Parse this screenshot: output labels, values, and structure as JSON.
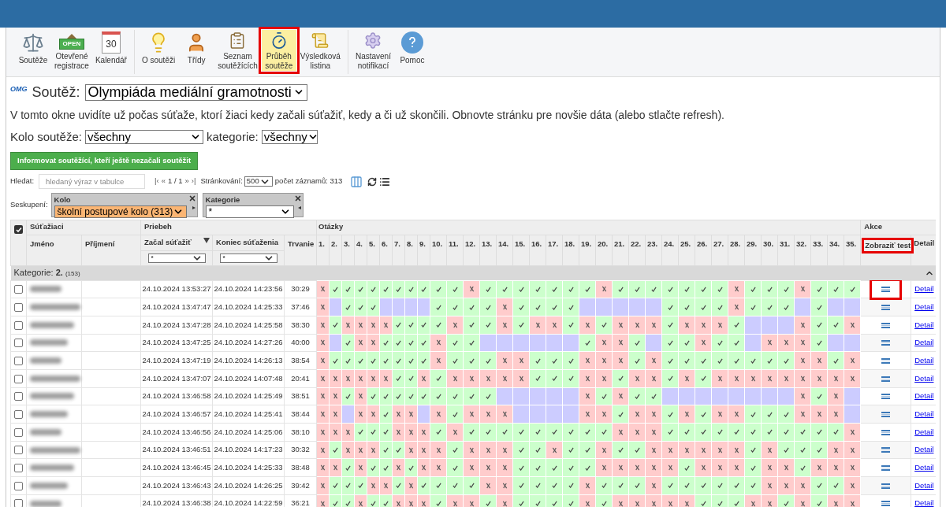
{
  "toolbar": {
    "groups": [
      [
        {
          "kind": "scale",
          "label": "Soutěže",
          "selected": false,
          "highlighted": false
        },
        {
          "kind": "sign",
          "sign_text": "OPEN",
          "label": "Otevřené\nregistrace",
          "selected": false,
          "highlighted": false
        },
        {
          "kind": "calendar",
          "sign_text": "30",
          "label": "Kalendář",
          "selected": false,
          "highlighted": false
        }
      ],
      [
        {
          "kind": "bulb",
          "label": "O soutěži",
          "selected": false,
          "highlighted": false
        },
        {
          "kind": "person",
          "label": "Třídy",
          "selected": false,
          "highlighted": false
        },
        {
          "kind": "clipboard",
          "label": "Seznam\nsoutěžících",
          "selected": false,
          "highlighted": false
        },
        {
          "kind": "stopwatch",
          "label": "Průběh\nsoutěže",
          "selected": true,
          "highlighted": true
        },
        {
          "kind": "certificate",
          "label": "Výsledková\nlistina",
          "selected": false,
          "highlighted": false
        }
      ],
      [
        {
          "kind": "gear",
          "label": "Nastavení\nnotifikací",
          "selected": false,
          "highlighted": false
        },
        {
          "kind": "help",
          "label": "Pomoc",
          "selected": false,
          "highlighted": false
        }
      ]
    ]
  },
  "competition": {
    "logo": "OMG",
    "label": "Soutěž:",
    "value": "Olympiáda mediální gramotnosti"
  },
  "description": "V tomto okne uvidíte už počas súťaže, ktorí žiaci kedy začali súťažiť, kedy a či už skončili. Obnovte stránku pre novšie dáta (alebo stlačte refresh).",
  "filters": [
    {
      "label": "Kolo soutěže:",
      "value": "všechny"
    },
    {
      "label": "kategorie:",
      "value": "všechny"
    }
  ],
  "notify_button": "Informovat soutěžící, kteří ještě nezačali soutěžit",
  "search": {
    "label": "Hledat:",
    "placeholder": "hledaný výraz v tabulce"
  },
  "pager": {
    "first": "|‹",
    "prev": "«",
    "page": "1 / 1",
    "next": "»",
    "last": "›|",
    "page_size_label": "Stránkování:",
    "page_size": "500",
    "count": "počet záznamů: 313"
  },
  "grouping": {
    "label": "Seskupení:",
    "groups": [
      {
        "title": "Kolo",
        "value": "školní postupové kolo (313)",
        "active": true,
        "arrow": "▸"
      },
      {
        "title": "Kategorie",
        "value": "*",
        "active": false,
        "arrow": "◂"
      }
    ]
  },
  "table": {
    "header_checked": true,
    "groups": [
      "Súťažiaci",
      "Priebeh",
      "Otázky",
      "Akce"
    ],
    "columns": [
      "Jméno",
      "Příjmení",
      "Začal súťažiť",
      "Koniec súťaženia",
      "Trvanie"
    ],
    "column_filters": [
      "*",
      "*"
    ],
    "questions": [
      "1.",
      "2.",
      "3.",
      "4.",
      "5.",
      "6.",
      "7.",
      "8.",
      "9.",
      "10.",
      "11.",
      "12.",
      "13.",
      "14.",
      "15.",
      "16.",
      "17.",
      "18.",
      "19.",
      "20.",
      "21.",
      "22.",
      "23.",
      "24.",
      "25.",
      "26.",
      "27.",
      "28.",
      "29.",
      "30.",
      "31.",
      "32.",
      "33.",
      "34.",
      "35."
    ],
    "actions": [
      {
        "label": "Zobraziť test",
        "highlighted": true
      },
      {
        "label": "Detail",
        "highlighted": false
      }
    ],
    "group_row": {
      "label": "Kategorie: **2.**",
      "count": "(153)",
      "expanded": true
    },
    "rows": [
      {
        "checked": false,
        "start": "24.10.2024 13:53:27",
        "end": "24.10.2024 14:23:56",
        "duration": "30:29",
        "test_highlighted": true,
        "detail": "Detail",
        "answers": [
          {
            "kind": "wrong"
          },
          {
            "kind": "correct"
          },
          {
            "kind": "correct"
          },
          {
            "kind": "correct"
          },
          {
            "kind": "correct"
          },
          {
            "kind": "correct"
          },
          {
            "kind": "correct"
          },
          {
            "kind": "correct"
          },
          {
            "kind": "correct"
          },
          {
            "kind": "correct"
          },
          {
            "kind": "correct"
          },
          {
            "kind": "wrong"
          },
          {
            "kind": "correct"
          },
          {
            "kind": "correct"
          },
          {
            "kind": "correct"
          },
          {
            "kind": "correct"
          },
          {
            "kind": "correct"
          },
          {
            "kind": "correct"
          },
          {
            "kind": "correct"
          },
          {
            "kind": "wrong"
          },
          {
            "kind": "correct"
          },
          {
            "kind": "correct"
          },
          {
            "kind": "correct"
          },
          {
            "kind": "correct"
          },
          {
            "kind": "correct"
          },
          {
            "kind": "correct"
          },
          {
            "kind": "correct"
          },
          {
            "kind": "wrong"
          },
          {
            "kind": "correct"
          },
          {
            "kind": "correct"
          },
          {
            "kind": "correct"
          },
          {
            "kind": "wrong"
          },
          {
            "kind": "correct"
          },
          {
            "kind": "correct"
          },
          {
            "kind": "correct"
          }
        ]
      },
      {
        "checked": false,
        "start": "24.10.2024 13:47:47",
        "end": "24.10.2024 14:25:33",
        "duration": "37:46",
        "test_highlighted": false,
        "detail": "Detail",
        "answers": [
          {
            "kind": "wrong"
          },
          {
            "kind": "empty"
          },
          {
            "kind": "correct"
          },
          {
            "kind": "correct"
          },
          {
            "kind": "correct"
          },
          {
            "kind": "empty"
          },
          {
            "kind": "empty"
          },
          {
            "kind": "empty"
          },
          {
            "kind": "empty"
          },
          {
            "kind": "correct"
          },
          {
            "kind": "correct"
          },
          {
            "kind": "correct"
          },
          {
            "kind": "correct"
          },
          {
            "kind": "wrong"
          },
          {
            "kind": "correct"
          },
          {
            "kind": "correct"
          },
          {
            "kind": "correct"
          },
          {
            "kind": "correct"
          },
          {
            "kind": "empty"
          },
          {
            "kind": "empty"
          },
          {
            "kind": "empty"
          },
          {
            "kind": "empty"
          },
          {
            "kind": "empty"
          },
          {
            "kind": "correct"
          },
          {
            "kind": "correct"
          },
          {
            "kind": "correct"
          },
          {
            "kind": "correct"
          },
          {
            "kind": "wrong"
          },
          {
            "kind": "correct"
          },
          {
            "kind": "correct"
          },
          {
            "kind": "correct"
          },
          {
            "kind": "empty"
          },
          {
            "kind": "correct"
          },
          {
            "kind": "empty"
          },
          {
            "kind": "empty"
          }
        ]
      },
      {
        "checked": false,
        "start": "24.10.2024 13:47:28",
        "end": "24.10.2024 14:25:58",
        "duration": "38:30",
        "test_highlighted": false,
        "detail": "Detail",
        "answers": [
          {
            "kind": "wrong"
          },
          {
            "kind": "correct"
          },
          {
            "kind": "wrong"
          },
          {
            "kind": "wrong"
          },
          {
            "kind": "wrong"
          },
          {
            "kind": "wrong"
          },
          {
            "kind": "correct"
          },
          {
            "kind": "correct"
          },
          {
            "kind": "correct"
          },
          {
            "kind": "correct"
          },
          {
            "kind": "wrong"
          },
          {
            "kind": "correct"
          },
          {
            "kind": "correct"
          },
          {
            "kind": "wrong"
          },
          {
            "kind": "correct"
          },
          {
            "kind": "wrong"
          },
          {
            "kind": "wrong"
          },
          {
            "kind": "correct"
          },
          {
            "kind": "wrong"
          },
          {
            "kind": "correct"
          },
          {
            "kind": "wrong"
          },
          {
            "kind": "wrong"
          },
          {
            "kind": "wrong"
          },
          {
            "kind": "correct"
          },
          {
            "kind": "wrong"
          },
          {
            "kind": "wrong"
          },
          {
            "kind": "wrong"
          },
          {
            "kind": "correct"
          },
          {
            "kind": "empty"
          },
          {
            "kind": "empty"
          },
          {
            "kind": "empty"
          },
          {
            "kind": "wrong"
          },
          {
            "kind": "correct"
          },
          {
            "kind": "correct"
          },
          {
            "kind": "wrong"
          }
        ]
      },
      {
        "checked": false,
        "start": "24.10.2024 13:47:25",
        "end": "24.10.2024 14:27:26",
        "duration": "40:00",
        "test_highlighted": false,
        "detail": "Detail",
        "answers": [
          {
            "kind": "wrong"
          },
          {
            "kind": "empty"
          },
          {
            "kind": "correct"
          },
          {
            "kind": "wrong"
          },
          {
            "kind": "wrong"
          },
          {
            "kind": "correct"
          },
          {
            "kind": "correct"
          },
          {
            "kind": "correct"
          },
          {
            "kind": "correct"
          },
          {
            "kind": "wrong"
          },
          {
            "kind": "correct"
          },
          {
            "kind": "correct"
          },
          {
            "kind": "empty"
          },
          {
            "kind": "empty"
          },
          {
            "kind": "empty"
          },
          {
            "kind": "empty"
          },
          {
            "kind": "empty"
          },
          {
            "kind": "empty"
          },
          {
            "kind": "correct"
          },
          {
            "kind": "wrong"
          },
          {
            "kind": "wrong"
          },
          {
            "kind": "correct"
          },
          {
            "kind": "empty"
          },
          {
            "kind": "correct"
          },
          {
            "kind": "correct"
          },
          {
            "kind": "wrong"
          },
          {
            "kind": "correct"
          },
          {
            "kind": "correct"
          },
          {
            "kind": "empty"
          },
          {
            "kind": "wrong"
          },
          {
            "kind": "wrong"
          },
          {
            "kind": "wrong"
          },
          {
            "kind": "correct"
          },
          {
            "kind": "empty"
          },
          {
            "kind": "empty"
          }
        ]
      },
      {
        "checked": false,
        "start": "24.10.2024 13:47:19",
        "end": "24.10.2024 14:26:13",
        "duration": "38:54",
        "test_highlighted": false,
        "detail": "Detail",
        "answers": [
          {
            "kind": "wrong"
          },
          {
            "kind": "correct"
          },
          {
            "kind": "correct"
          },
          {
            "kind": "correct"
          },
          {
            "kind": "correct"
          },
          {
            "kind": "correct"
          },
          {
            "kind": "correct"
          },
          {
            "kind": "correct"
          },
          {
            "kind": "correct"
          },
          {
            "kind": "wrong"
          },
          {
            "kind": "correct"
          },
          {
            "kind": "correct"
          },
          {
            "kind": "correct"
          },
          {
            "kind": "wrong"
          },
          {
            "kind": "wrong"
          },
          {
            "kind": "correct"
          },
          {
            "kind": "correct"
          },
          {
            "kind": "correct"
          },
          {
            "kind": "wrong"
          },
          {
            "kind": "wrong"
          },
          {
            "kind": "wrong"
          },
          {
            "kind": "correct"
          },
          {
            "kind": "wrong"
          },
          {
            "kind": "correct"
          },
          {
            "kind": "correct"
          },
          {
            "kind": "correct"
          },
          {
            "kind": "correct"
          },
          {
            "kind": "correct"
          },
          {
            "kind": "correct"
          },
          {
            "kind": "correct"
          },
          {
            "kind": "correct"
          },
          {
            "kind": "wrong"
          },
          {
            "kind": "wrong"
          },
          {
            "kind": "correct"
          },
          {
            "kind": "wrong"
          }
        ]
      },
      {
        "checked": false,
        "start": "24.10.2024 13:47:07",
        "end": "24.10.2024 14:07:48",
        "duration": "20:41",
        "test_highlighted": false,
        "detail": "Detail",
        "answers": [
          {
            "kind": "wrong"
          },
          {
            "kind": "wrong"
          },
          {
            "kind": "wrong"
          },
          {
            "kind": "wrong"
          },
          {
            "kind": "wrong"
          },
          {
            "kind": "wrong"
          },
          {
            "kind": "correct"
          },
          {
            "kind": "correct"
          },
          {
            "kind": "wrong"
          },
          {
            "kind": "correct"
          },
          {
            "kind": "wrong"
          },
          {
            "kind": "wrong"
          },
          {
            "kind": "wrong"
          },
          {
            "kind": "wrong"
          },
          {
            "kind": "wrong"
          },
          {
            "kind": "correct"
          },
          {
            "kind": "correct"
          },
          {
            "kind": "correct"
          },
          {
            "kind": "wrong"
          },
          {
            "kind": "wrong"
          },
          {
            "kind": "correct"
          },
          {
            "kind": "wrong"
          },
          {
            "kind": "wrong"
          },
          {
            "kind": "correct"
          },
          {
            "kind": "wrong"
          },
          {
            "kind": "correct"
          },
          {
            "kind": "wrong"
          },
          {
            "kind": "wrong"
          },
          {
            "kind": "wrong"
          },
          {
            "kind": "wrong"
          },
          {
            "kind": "wrong"
          },
          {
            "kind": "wrong"
          },
          {
            "kind": "wrong"
          },
          {
            "kind": "wrong"
          },
          {
            "kind": "wrong"
          }
        ]
      },
      {
        "checked": false,
        "start": "24.10.2024 13:46:58",
        "end": "24.10.2024 14:25:49",
        "duration": "38:51",
        "test_highlighted": false,
        "detail": "Detail",
        "answers": [
          {
            "kind": "wrong"
          },
          {
            "kind": "wrong"
          },
          {
            "kind": "correct"
          },
          {
            "kind": "wrong"
          },
          {
            "kind": "correct"
          },
          {
            "kind": "correct"
          },
          {
            "kind": "correct"
          },
          {
            "kind": "correct"
          },
          {
            "kind": "correct"
          },
          {
            "kind": "correct"
          },
          {
            "kind": "correct"
          },
          {
            "kind": "correct"
          },
          {
            "kind": "correct"
          },
          {
            "kind": "empty"
          },
          {
            "kind": "empty"
          },
          {
            "kind": "empty"
          },
          {
            "kind": "empty"
          },
          {
            "kind": "empty"
          },
          {
            "kind": "wrong"
          },
          {
            "kind": "correct"
          },
          {
            "kind": "wrong"
          },
          {
            "kind": "correct"
          },
          {
            "kind": "correct"
          },
          {
            "kind": "empty"
          },
          {
            "kind": "empty"
          },
          {
            "kind": "empty"
          },
          {
            "kind": "empty"
          },
          {
            "kind": "empty"
          },
          {
            "kind": "empty"
          },
          {
            "kind": "empty"
          },
          {
            "kind": "empty"
          },
          {
            "kind": "wrong"
          },
          {
            "kind": "correct"
          },
          {
            "kind": "wrong"
          },
          {
            "kind": "empty"
          }
        ]
      },
      {
        "checked": false,
        "start": "24.10.2024 13:46:57",
        "end": "24.10.2024 14:25:41",
        "duration": "38:44",
        "test_highlighted": false,
        "detail": "Detail",
        "answers": [
          {
            "kind": "wrong"
          },
          {
            "kind": "wrong"
          },
          {
            "kind": "empty"
          },
          {
            "kind": "wrong"
          },
          {
            "kind": "wrong"
          },
          {
            "kind": "correct"
          },
          {
            "kind": "wrong"
          },
          {
            "kind": "wrong"
          },
          {
            "kind": "empty"
          },
          {
            "kind": "wrong"
          },
          {
            "kind": "correct"
          },
          {
            "kind": "wrong"
          },
          {
            "kind": "wrong"
          },
          {
            "kind": "wrong"
          },
          {
            "kind": "empty"
          },
          {
            "kind": "empty"
          },
          {
            "kind": "empty"
          },
          {
            "kind": "empty"
          },
          {
            "kind": "wrong"
          },
          {
            "kind": "wrong"
          },
          {
            "kind": "correct"
          },
          {
            "kind": "wrong"
          },
          {
            "kind": "wrong"
          },
          {
            "kind": "correct"
          },
          {
            "kind": "wrong"
          },
          {
            "kind": "correct"
          },
          {
            "kind": "wrong"
          },
          {
            "kind": "wrong"
          },
          {
            "kind": "correct"
          },
          {
            "kind": "correct"
          },
          {
            "kind": "correct"
          },
          {
            "kind": "wrong"
          },
          {
            "kind": "wrong"
          },
          {
            "kind": "wrong"
          },
          {
            "kind": "empty"
          }
        ]
      },
      {
        "checked": false,
        "start": "24.10.2024 13:46:56",
        "end": "24.10.2024 14:25:06",
        "duration": "38:10",
        "test_highlighted": false,
        "detail": "Detail",
        "answers": [
          {
            "kind": "wrong"
          },
          {
            "kind": "wrong"
          },
          {
            "kind": "wrong"
          },
          {
            "kind": "correct"
          },
          {
            "kind": "correct"
          },
          {
            "kind": "correct"
          },
          {
            "kind": "wrong"
          },
          {
            "kind": "wrong"
          },
          {
            "kind": "wrong"
          },
          {
            "kind": "correct"
          },
          {
            "kind": "wrong"
          },
          {
            "kind": "correct"
          },
          {
            "kind": "correct"
          },
          {
            "kind": "correct"
          },
          {
            "kind": "correct"
          },
          {
            "kind": "correct"
          },
          {
            "kind": "correct"
          },
          {
            "kind": "correct"
          },
          {
            "kind": "correct"
          },
          {
            "kind": "correct"
          },
          {
            "kind": "wrong"
          },
          {
            "kind": "wrong"
          },
          {
            "kind": "wrong"
          },
          {
            "kind": "correct"
          },
          {
            "kind": "correct"
          },
          {
            "kind": "correct"
          },
          {
            "kind": "correct"
          },
          {
            "kind": "correct"
          },
          {
            "kind": "correct"
          },
          {
            "kind": "correct"
          },
          {
            "kind": "correct"
          },
          {
            "kind": "correct"
          },
          {
            "kind": "correct"
          },
          {
            "kind": "correct"
          },
          {
            "kind": "wrong"
          }
        ]
      },
      {
        "checked": false,
        "start": "24.10.2024 13:46:51",
        "end": "24.10.2024 14:17:23",
        "duration": "30:32",
        "test_highlighted": false,
        "detail": "Detail",
        "answers": [
          {
            "kind": "wrong"
          },
          {
            "kind": "correct"
          },
          {
            "kind": "wrong"
          },
          {
            "kind": "wrong"
          },
          {
            "kind": "wrong"
          },
          {
            "kind": "correct"
          },
          {
            "kind": "correct"
          },
          {
            "kind": "wrong"
          },
          {
            "kind": "wrong"
          },
          {
            "kind": "wrong"
          },
          {
            "kind": "correct"
          },
          {
            "kind": "wrong"
          },
          {
            "kind": "wrong"
          },
          {
            "kind": "wrong"
          },
          {
            "kind": "correct"
          },
          {
            "kind": "correct"
          },
          {
            "kind": "wrong"
          },
          {
            "kind": "correct"
          },
          {
            "kind": "correct"
          },
          {
            "kind": "wrong"
          },
          {
            "kind": "correct"
          },
          {
            "kind": "correct"
          },
          {
            "kind": "wrong"
          },
          {
            "kind": "wrong"
          },
          {
            "kind": "wrong"
          },
          {
            "kind": "wrong"
          },
          {
            "kind": "wrong"
          },
          {
            "kind": "wrong"
          },
          {
            "kind": "correct"
          },
          {
            "kind": "wrong"
          },
          {
            "kind": "correct"
          },
          {
            "kind": "correct"
          },
          {
            "kind": "correct"
          },
          {
            "kind": "wrong"
          },
          {
            "kind": "wrong"
          }
        ]
      },
      {
        "checked": false,
        "start": "24.10.2024 13:46:45",
        "end": "24.10.2024 14:25:33",
        "duration": "38:48",
        "test_highlighted": false,
        "detail": "Detail",
        "answers": [
          {
            "kind": "wrong"
          },
          {
            "kind": "wrong"
          },
          {
            "kind": "correct"
          },
          {
            "kind": "wrong"
          },
          {
            "kind": "correct"
          },
          {
            "kind": "correct"
          },
          {
            "kind": "wrong"
          },
          {
            "kind": "correct"
          },
          {
            "kind": "wrong"
          },
          {
            "kind": "wrong"
          },
          {
            "kind": "correct"
          },
          {
            "kind": "wrong"
          },
          {
            "kind": "wrong"
          },
          {
            "kind": "wrong"
          },
          {
            "kind": "correct"
          },
          {
            "kind": "correct"
          },
          {
            "kind": "correct"
          },
          {
            "kind": "correct"
          },
          {
            "kind": "correct"
          },
          {
            "kind": "wrong"
          },
          {
            "kind": "wrong"
          },
          {
            "kind": "wrong"
          },
          {
            "kind": "wrong"
          },
          {
            "kind": "wrong"
          },
          {
            "kind": "correct"
          },
          {
            "kind": "wrong"
          },
          {
            "kind": "wrong"
          },
          {
            "kind": "wrong"
          },
          {
            "kind": "correct"
          },
          {
            "kind": "wrong"
          },
          {
            "kind": "wrong"
          },
          {
            "kind": "correct"
          },
          {
            "kind": "wrong"
          },
          {
            "kind": "wrong"
          },
          {
            "kind": "wrong"
          }
        ]
      },
      {
        "checked": false,
        "start": "24.10.2024 13:46:43",
        "end": "24.10.2024 14:26:25",
        "duration": "39:42",
        "test_highlighted": false,
        "detail": "Detail",
        "answers": [
          {
            "kind": "wrong"
          },
          {
            "kind": "correct"
          },
          {
            "kind": "correct"
          },
          {
            "kind": "correct"
          },
          {
            "kind": "wrong"
          },
          {
            "kind": "wrong"
          },
          {
            "kind": "correct"
          },
          {
            "kind": "wrong"
          },
          {
            "kind": "correct"
          },
          {
            "kind": "correct"
          },
          {
            "kind": "correct"
          },
          {
            "kind": "correct"
          },
          {
            "kind": "wrong"
          },
          {
            "kind": "wrong"
          },
          {
            "kind": "correct"
          },
          {
            "kind": "correct"
          },
          {
            "kind": "correct"
          },
          {
            "kind": "correct"
          },
          {
            "kind": "wrong"
          },
          {
            "kind": "correct"
          },
          {
            "kind": "correct"
          },
          {
            "kind": "correct"
          },
          {
            "kind": "wrong"
          },
          {
            "kind": "correct"
          },
          {
            "kind": "correct"
          },
          {
            "kind": "correct"
          },
          {
            "kind": "correct"
          },
          {
            "kind": "correct"
          },
          {
            "kind": "correct"
          },
          {
            "kind": "wrong"
          },
          {
            "kind": "wrong"
          },
          {
            "kind": "wrong"
          },
          {
            "kind": "correct"
          },
          {
            "kind": "correct"
          },
          {
            "kind": "wrong"
          }
        ]
      },
      {
        "checked": false,
        "start": "24.10.2024 13:46:38",
        "end": "24.10.2024 14:22:59",
        "duration": "36:21",
        "test_highlighted": false,
        "detail": "Detail",
        "answers": [
          {
            "kind": "wrong"
          },
          {
            "kind": "correct"
          },
          {
            "kind": "correct"
          },
          {
            "kind": "wrong"
          },
          {
            "kind": "correct"
          },
          {
            "kind": "correct"
          },
          {
            "kind": "wrong"
          },
          {
            "kind": "wrong"
          },
          {
            "kind": "wrong"
          },
          {
            "kind": "correct"
          },
          {
            "kind": "wrong"
          },
          {
            "kind": "wrong"
          },
          {
            "kind": "correct"
          },
          {
            "kind": "wrong"
          },
          {
            "kind": "correct"
          },
          {
            "kind": "correct"
          },
          {
            "kind": "correct"
          },
          {
            "kind": "correct"
          },
          {
            "kind": "wrong"
          },
          {
            "kind": "correct"
          },
          {
            "kind": "wrong"
          },
          {
            "kind": "wrong"
          },
          {
            "kind": "wrong"
          },
          {
            "kind": "wrong"
          },
          {
            "kind": "wrong"
          },
          {
            "kind": "correct"
          },
          {
            "kind": "correct"
          },
          {
            "kind": "correct"
          },
          {
            "kind": "wrong"
          },
          {
            "kind": "wrong"
          },
          {
            "kind": "correct"
          },
          {
            "kind": "wrong"
          },
          {
            "kind": "correct"
          },
          {
            "kind": "wrong"
          },
          {
            "kind": "wrong"
          }
        ]
      }
    ]
  }
}
